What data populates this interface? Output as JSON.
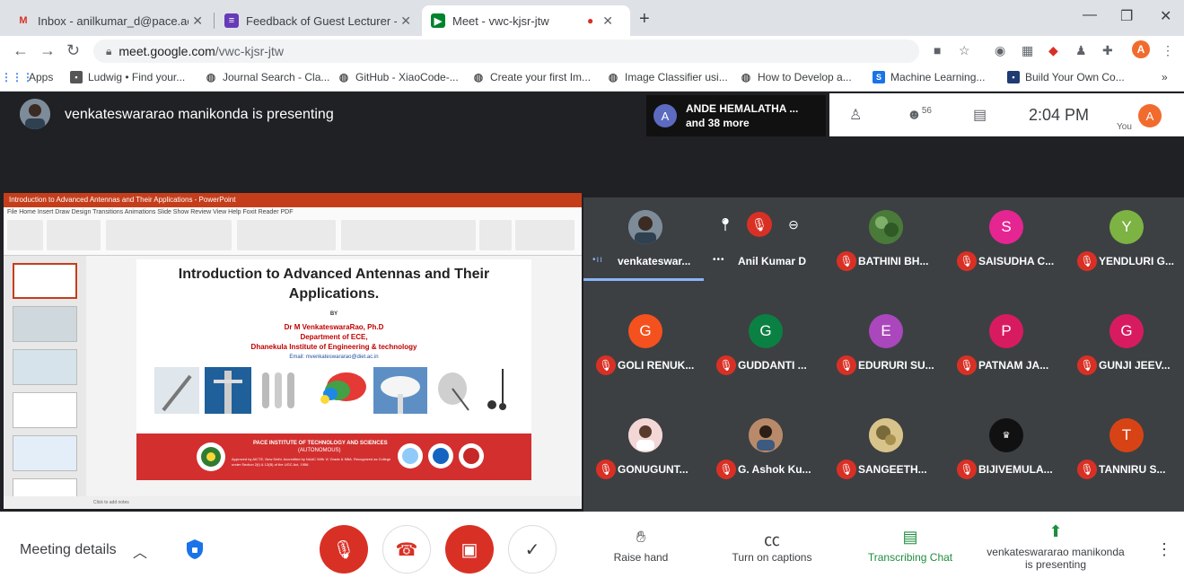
{
  "tabs": [
    {
      "title": "Inbox - anilkumar_d@pace.ac.in",
      "icon": "gmail-icon"
    },
    {
      "title": "Feedback of Guest Lecturer - Go",
      "icon": "forms-icon"
    },
    {
      "title": "Meet - vwc-kjsr-jtw",
      "icon": "meet-icon"
    }
  ],
  "address": {
    "domain": "meet.google.com",
    "path": "/vwc-kjsr-jtw"
  },
  "profile_initial": "A",
  "bookmarks": [
    "Apps",
    "Ludwig • Find your...",
    "Journal Search - Cla...",
    "GitHub - XiaoCode-...",
    "Create your first Im...",
    "Image Classifier usi...",
    "How to Develop a...",
    "Machine Learning...",
    "Build Your Own Co..."
  ],
  "bookmarks_more": "»",
  "meet": {
    "presenting": "venkateswararao manikonda is presenting",
    "joined": {
      "name": "ANDE HEMALATHA ...",
      "more": "and 38 more",
      "initial": "A"
    },
    "participants_count": "56",
    "time": "2:04 PM",
    "you_label": "You",
    "you_initial": "A"
  },
  "slide": {
    "ppt_title": "Introduction to Advanced Antennas and Their Applications - PowerPoint",
    "menu": "File  Home  Insert  Draw  Design  Transitions  Animations  Slide Show  Review  View  Help  Foxit Reader PDF",
    "title": "Introduction to Advanced Antennas and Their Applications.",
    "by": "BY",
    "author": "Dr M VenkateswaraRao, Ph.D",
    "dept": "Department of ECE,",
    "institute": "Dhanekula Institute of Engineering & technology",
    "email": "Email: mvenkateswararao@diet.ac.in",
    "footer_inst": "PACE INSTITUTE OF TECHNOLOGY AND SCIENCES",
    "footer_auto": "(AUTONOMOUS)",
    "footer_approved": "Approved by AICTE, New Delhi. Accredited by NAAC With 'A' Grade & NBA. Recognized as College under Section 2(f) & 12(B) of the UGC Act, 1956.",
    "notes": "Click to add notes"
  },
  "participants": [
    {
      "name": "venkateswar...",
      "initial": "",
      "color": "#6a7a8a",
      "muted": false,
      "speaking": true
    },
    {
      "name": "Anil Kumar D",
      "initial": "",
      "color": "",
      "muted": false,
      "speaking": true
    },
    {
      "name": "BATHINI BH...",
      "initial": "",
      "color": "#4a7a3a",
      "muted": true
    },
    {
      "name": "SAISUDHA C...",
      "initial": "S",
      "color": "#e52592",
      "muted": true
    },
    {
      "name": "YENDLURI G...",
      "initial": "Y",
      "color": "#7cb342",
      "muted": true
    },
    {
      "name": "GOLI RENUK...",
      "initial": "G",
      "color": "#f4511e",
      "muted": true
    },
    {
      "name": "GUDDANTI ...",
      "initial": "G",
      "color": "#0b8043",
      "muted": true
    },
    {
      "name": "EDURURI SU...",
      "initial": "E",
      "color": "#ab47bc",
      "muted": true
    },
    {
      "name": "PATNAM JA...",
      "initial": "P",
      "color": "#d81b60",
      "muted": true
    },
    {
      "name": "GUNJI JEEV...",
      "initial": "G",
      "color": "#d81b60",
      "muted": true
    },
    {
      "name": "GONUGUNT...",
      "initial": "",
      "color": "#f5c6c6",
      "muted": true
    },
    {
      "name": "G. Ashok Ku...",
      "initial": "",
      "color": "#a0674a",
      "muted": true
    },
    {
      "name": "SANGEETH...",
      "initial": "",
      "color": "#c9b36a",
      "muted": true
    },
    {
      "name": "BIJIVEMULA...",
      "initial": "",
      "color": "#111111",
      "muted": true
    },
    {
      "name": "TANNIRU S...",
      "initial": "T",
      "color": "#d84315",
      "muted": true
    }
  ],
  "bottom": {
    "meeting_details": "Meeting details",
    "raise_hand": "Raise hand",
    "captions": "Turn on captions",
    "chat": "Transcribing Chat",
    "presenting_1": "venkateswararao manikonda",
    "presenting_2": "is presenting"
  }
}
